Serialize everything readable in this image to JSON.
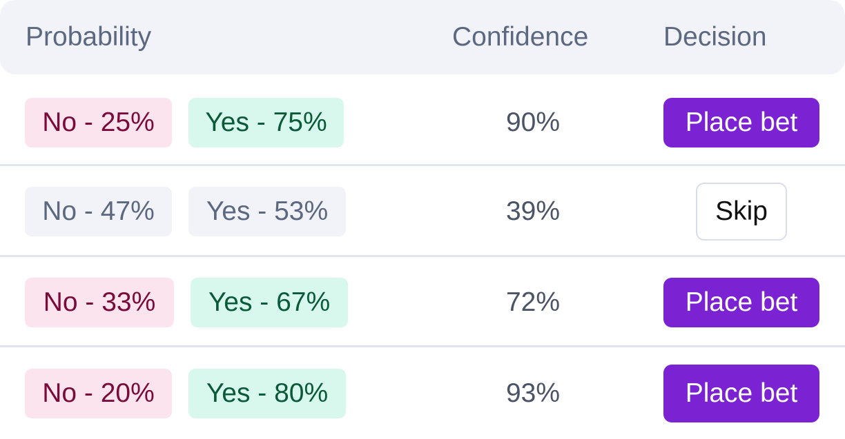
{
  "header": {
    "probability": "Probability",
    "confidence": "Confidence",
    "decision": "Decision"
  },
  "rows": [
    {
      "no": "No - 25%",
      "yes": "Yes - 75%",
      "confidence": "90%",
      "decision": "Place bet",
      "style": "highlight"
    },
    {
      "no": "No - 47%",
      "yes": "Yes - 53%",
      "confidence": "39%",
      "decision": "Skip",
      "style": "neutral"
    },
    {
      "no": "No - 33%",
      "yes": "Yes - 67%",
      "confidence": "72%",
      "decision": "Place bet",
      "style": "highlight"
    },
    {
      "no": "No - 20%",
      "yes": "Yes - 80%",
      "confidence": "93%",
      "decision": "Place bet",
      "style": "highlight"
    }
  ],
  "colors": {
    "header_bg": "#f1f3f8",
    "no_bg": "#fbe4ee",
    "no_text": "#7a0a3a",
    "yes_bg": "#d8f8ee",
    "yes_text": "#0a5a3a",
    "neutral_bg": "#f1f3f8",
    "neutral_text": "#5b6880",
    "primary_button": "#7b22d3"
  }
}
